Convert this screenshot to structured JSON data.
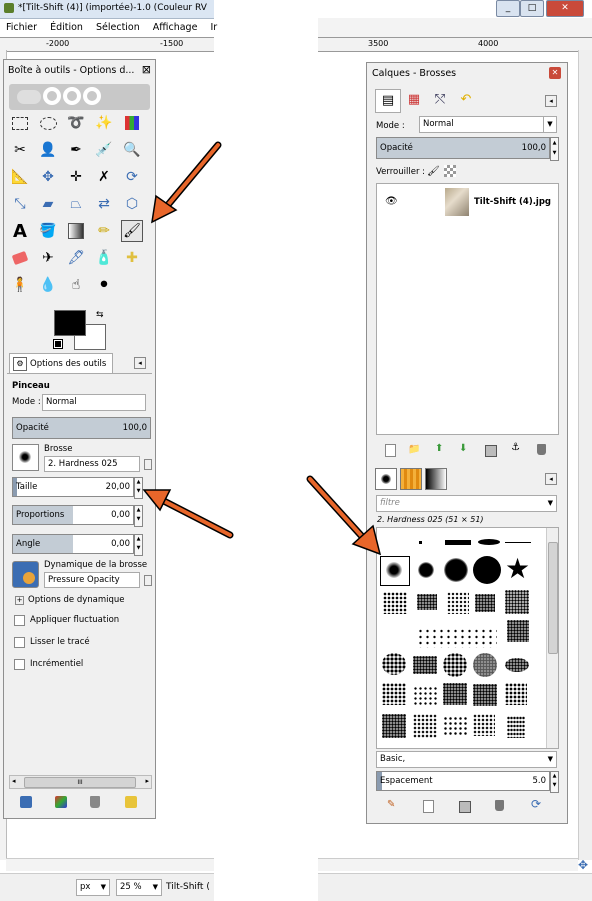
{
  "left_window": {
    "title": "*[Tilt-Shift (4)] (importée)-1.0 (Couleur RV",
    "menu": [
      "Fichier",
      "Édition",
      "Sélection",
      "Affichage",
      "Ir"
    ],
    "ruler_labels": [
      "-2000",
      "-1500"
    ],
    "zoom_unit": "px",
    "zoom_level": "25 %",
    "status_text": "Tilt-Shift ("
  },
  "right_window": {
    "ruler_labels": [
      "3500",
      "4000"
    ]
  },
  "toolbox": {
    "title": "Boîte à outils - Options d...",
    "close": "⊠",
    "tab_label": "Options des outils",
    "section": "Pinceau",
    "mode_label": "Mode :",
    "mode_value": "Normal",
    "opacity_label": "Opacité",
    "opacity_value": "100,0",
    "brush_label": "Brosse",
    "brush_value": "2. Hardness 025",
    "size_label": "Taille",
    "size_value": "20,00",
    "aspect_label": "Proportions",
    "aspect_value": "0,00",
    "angle_label": "Angle",
    "angle_value": "0,00",
    "dynamics_label": "Dynamique de la brosse",
    "dynamics_value": "Pressure Opacity",
    "dynamics_options": "Options de dynamique",
    "apply_jitter": "Appliquer fluctuation",
    "smooth_stroke": "Lisser le tracé",
    "incremental": "Incrémentiel",
    "scroll_grip": "III"
  },
  "layers": {
    "title": "Calques - Brosses",
    "mode_label": "Mode :",
    "mode_value": "Normal",
    "opacity_label": "Opacité",
    "opacity_value": "100,0",
    "lock_label": "Verrouiller :",
    "layer_name": "Tilt-Shift (4).jpg",
    "filter_placeholder": "filtre",
    "brush_name": "2. Hardness 025 (51 × 51)",
    "brush_set": "Basic,",
    "spacing_label": "Espacement",
    "spacing_value": "5.0"
  },
  "colors": {
    "arrow": "#e8662a",
    "accent": "#c3ccd5"
  }
}
